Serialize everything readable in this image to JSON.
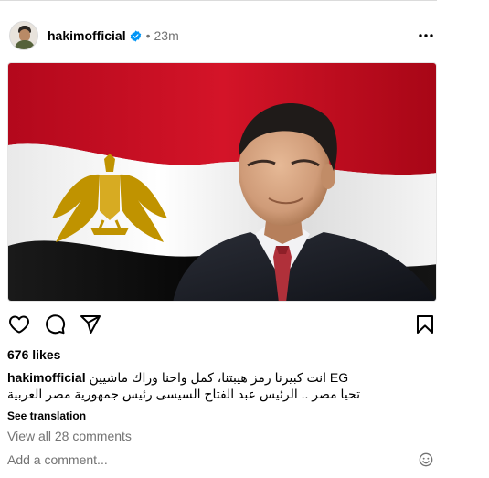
{
  "post": {
    "username": "hakimofficial",
    "verified_icon": "verified-badge-icon",
    "separator": "•",
    "time": "23m",
    "more_icon": "more-options-icon",
    "image": {
      "description_icon": "flag-portrait-photo",
      "colors": {
        "red": "#c8102e",
        "white": "#ffffff",
        "black": "#000000",
        "eagle": "#c09300"
      }
    },
    "actions": {
      "like_icon": "heart-icon",
      "comment_icon": "comment-icon",
      "share_icon": "share-icon",
      "save_icon": "bookmark-icon"
    },
    "likes": "676 likes",
    "caption": {
      "user": "hakimofficial",
      "line1": "EG انت كبيرنا رمز هيبتنا، كمل واحنا وراك ماشيين",
      "line2": "تحيا مصر .. الرئيس عبد الفتاح السيسى رئيس جمهورية مصر العربية"
    },
    "see_translation": "See translation",
    "view_comments": "View all 28 comments",
    "add_comment_placeholder": "Add a comment...",
    "emoji_icon": "emoji-icon"
  }
}
